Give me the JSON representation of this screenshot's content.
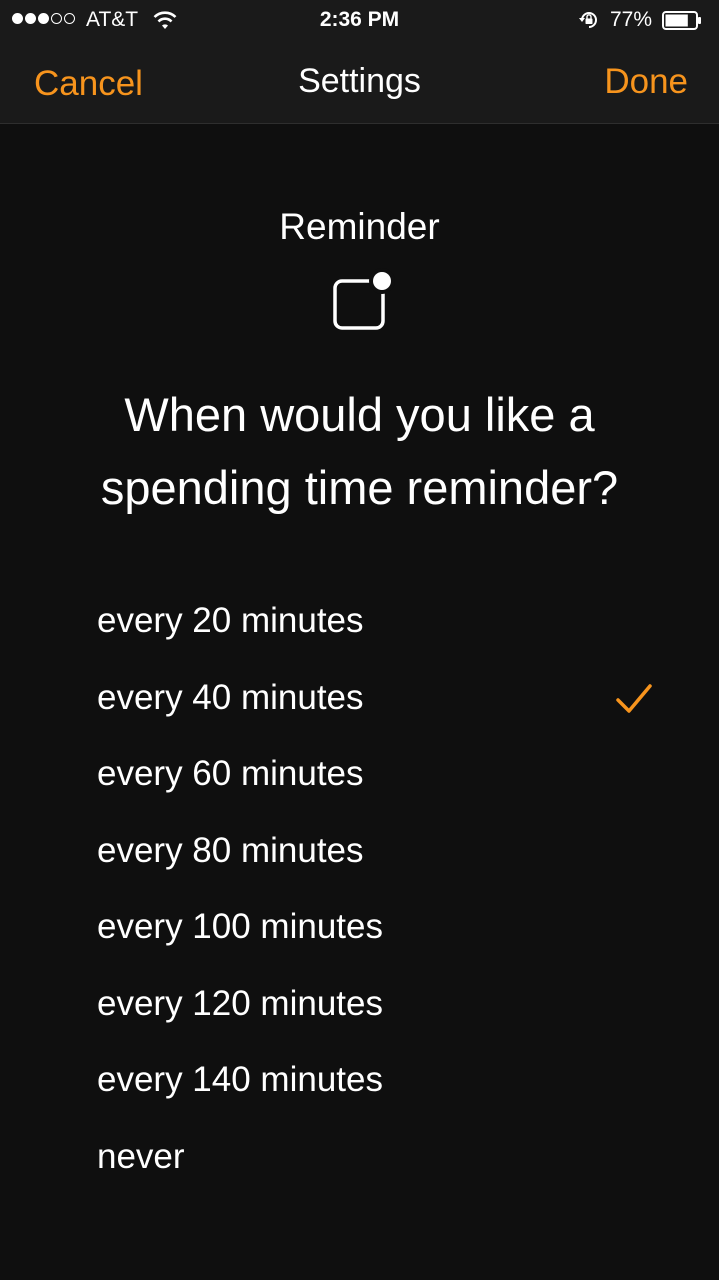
{
  "status_bar": {
    "carrier": "AT&T",
    "signal_bars_filled": 3,
    "signal_bars_total": 5,
    "time": "2:36 PM",
    "battery_percent": "77%",
    "battery_level": 0.77,
    "icons": [
      "signal-icon",
      "wifi-icon",
      "rotation-lock-icon",
      "battery-icon"
    ]
  },
  "nav": {
    "cancel_label": "Cancel",
    "title": "Settings",
    "done_label": "Done"
  },
  "section": {
    "label": "Reminder",
    "icon": "notification-badge-icon"
  },
  "question": "When would you like a spending time reminder?",
  "options": [
    {
      "label": "every 20 minutes",
      "selected": false
    },
    {
      "label": "every 40 minutes",
      "selected": true
    },
    {
      "label": "every 60 minutes",
      "selected": false
    },
    {
      "label": "every 80 minutes",
      "selected": false
    },
    {
      "label": "every 100 minutes",
      "selected": false
    },
    {
      "label": "every 120 minutes",
      "selected": false
    },
    {
      "label": "every 140 minutes",
      "selected": false
    },
    {
      "label": "never",
      "selected": false
    }
  ],
  "colors": {
    "accent": "#f7941d",
    "background": "#0f0f0f",
    "bar_background": "#1a1a1a",
    "text": "#ffffff"
  }
}
